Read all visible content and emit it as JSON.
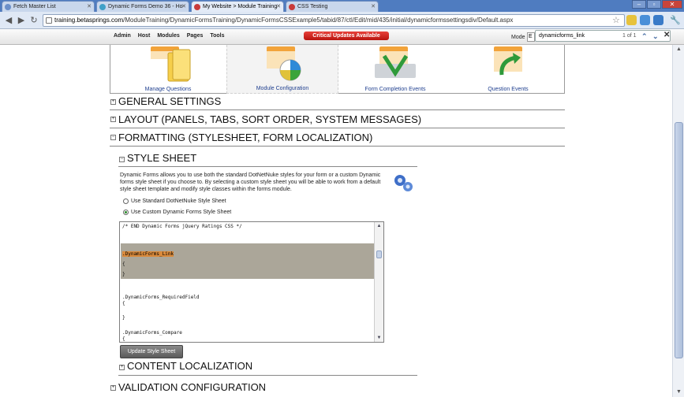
{
  "browser": {
    "tabs": [
      {
        "title": "Fetch Master List",
        "active": false
      },
      {
        "title": "Dynamic Forms Demo 36 - Ho",
        "active": false
      },
      {
        "title": "My Website > Module Training",
        "active": true
      },
      {
        "title": "CSS Testing",
        "active": false
      }
    ],
    "address_host": "training.betasprings.com",
    "address_path": "/ModuleTraining/DynamicFormsTraining/DynamicFormsCSSExample5/tabid/87/ctl/Edit/mid/435/initial/dynamicformssettingsdiv/Default.aspx"
  },
  "control_bar": {
    "menu": [
      "Admin",
      "Host",
      "Modules",
      "Pages",
      "Tools"
    ],
    "critical_label": "Critical Updates Available",
    "mode_label": "Mode",
    "mode_value": "E"
  },
  "find": {
    "query": "dynamicforms_link",
    "count": "1 of 1"
  },
  "icons": [
    {
      "label": "Manage Questions"
    },
    {
      "label": "Module Configuration"
    },
    {
      "label": "Form Completion Events"
    },
    {
      "label": "Question Events"
    }
  ],
  "sections": {
    "general": {
      "title": "GENERAL SETTINGS",
      "expander": "+"
    },
    "layout": {
      "title": "LAYOUT (PANELS, TABS, SORT ORDER, SYSTEM MESSAGES)",
      "expander": "+"
    },
    "formatting": {
      "title": "FORMATTING (STYLESHEET, FORM LOCALIZATION)",
      "expander": "−"
    },
    "stylesheet": {
      "title": "STYLE SHEET",
      "expander": "−"
    },
    "localization": {
      "title": "CONTENT LOCALIZATION",
      "expander": "+"
    },
    "validation": {
      "title": "VALIDATION CONFIGURATION",
      "expander": "+"
    }
  },
  "stylesheet": {
    "description": "Dynamic Forms allows you to use both the standard DotNetNuke styles for your form or a custom Dynamic forms style sheet if you choose to. By selecting a custom style sheet you will be able to work from a default style sheet template and modify style classes within the forms module.",
    "option_standard": "Use Standard DotNetNuke Style Sheet",
    "option_custom": "Use Custom Dynamic Forms Style Sheet",
    "selected_option": "custom",
    "code_lines": [
      "/* END Dynamic Forms jQuery Ratings CSS */",
      ".DynamicForms_Link",
      "{",
      "}",
      ".DynamicForms_RequiredField",
      "{",
      "}",
      ".DynamicForms_Compare",
      "{"
    ],
    "update_button": "Update Style Sheet"
  }
}
